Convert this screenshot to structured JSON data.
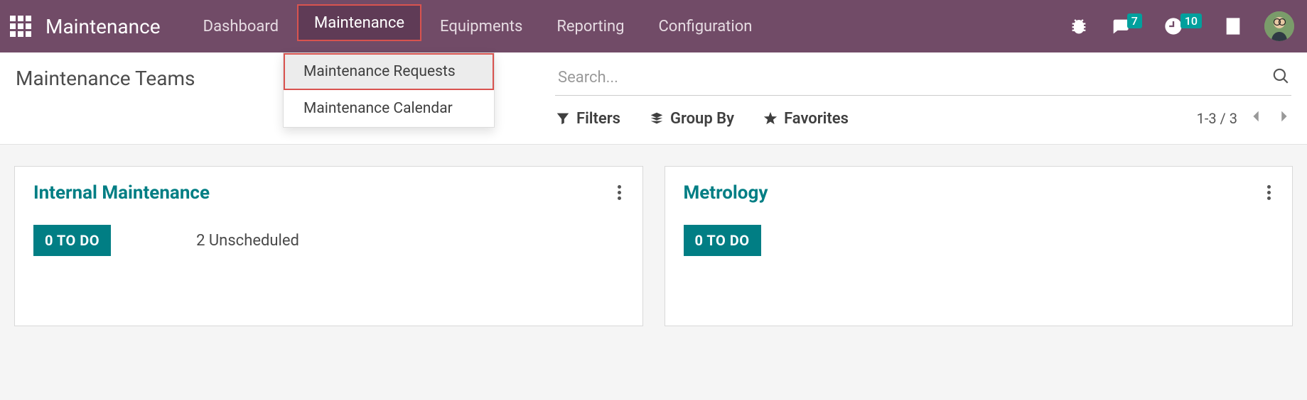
{
  "brand": "Maintenance",
  "nav": {
    "dashboard": "Dashboard",
    "maintenance": "Maintenance",
    "equipments": "Equipments",
    "reporting": "Reporting",
    "configuration": "Configuration"
  },
  "systray": {
    "messages_count": "7",
    "activities_count": "10"
  },
  "dropdown": {
    "requests": "Maintenance Requests",
    "calendar": "Maintenance Calendar"
  },
  "breadcrumb": {
    "title": "Maintenance Teams"
  },
  "search": {
    "placeholder": "Search..."
  },
  "controls": {
    "filters": "Filters",
    "group_by": "Group By",
    "favorites": "Favorites",
    "pager": "1-3 / 3"
  },
  "teams": {
    "card1": {
      "title": "Internal Maintenance",
      "todo": "0 TO DO",
      "unscheduled": "2 Unscheduled"
    },
    "card2": {
      "title": "Metrology",
      "todo": "0 TO DO"
    }
  },
  "colors": {
    "navbar": "#714b67",
    "accent": "#017e84",
    "badge": "#00a09d",
    "highlight": "#d9534f"
  }
}
